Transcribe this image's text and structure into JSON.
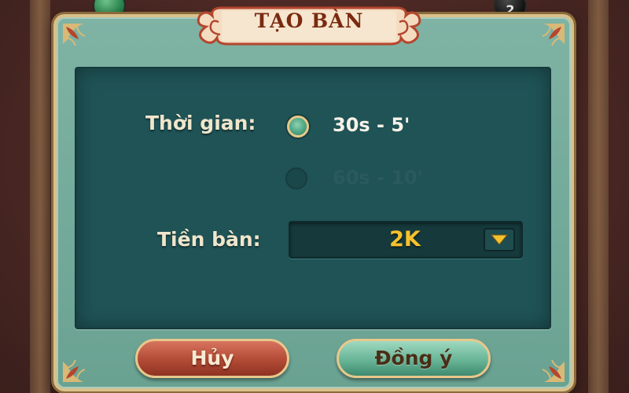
{
  "background": {
    "piece_right_label": "2"
  },
  "dialog": {
    "title": "TẠO BÀN",
    "time_label": "Thời gian:",
    "time_options": [
      {
        "label": "30s - 5'",
        "selected": true
      },
      {
        "label": "60s - 10'",
        "selected": false
      }
    ],
    "money_label": "Tiền bàn:",
    "money_value": "2K",
    "cancel_label": "Hủy",
    "confirm_label": "Đồng ý"
  },
  "colors": {
    "frame": "#7fb3a4",
    "panel": "#1f5356",
    "gold": "#f5c12d",
    "cancel": "#b24a36",
    "confirm": "#68b597"
  }
}
